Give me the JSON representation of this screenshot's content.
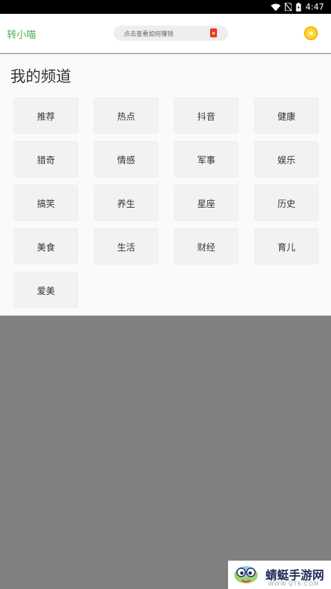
{
  "status_bar": {
    "time": "4:47"
  },
  "header": {
    "app_title": "转小喵",
    "search_placeholder": "点击查看如何赚钱"
  },
  "channels": {
    "title": "我的频道",
    "items": [
      "推荐",
      "热点",
      "抖音",
      "健康",
      "猎奇",
      "情感",
      "军事",
      "娱乐",
      "搞笑",
      "养生",
      "星座",
      "历史",
      "美食",
      "生活",
      "财经",
      "育儿",
      "爱美"
    ]
  },
  "watermark": {
    "name": "蜻蜓手游网",
    "url": "WWW.QT6.COM"
  },
  "colors": {
    "accent_green": "#4caf50",
    "overlay_gray": "#808080",
    "red_packet": "#e53935",
    "coin_yellow": "#ffd43b"
  }
}
